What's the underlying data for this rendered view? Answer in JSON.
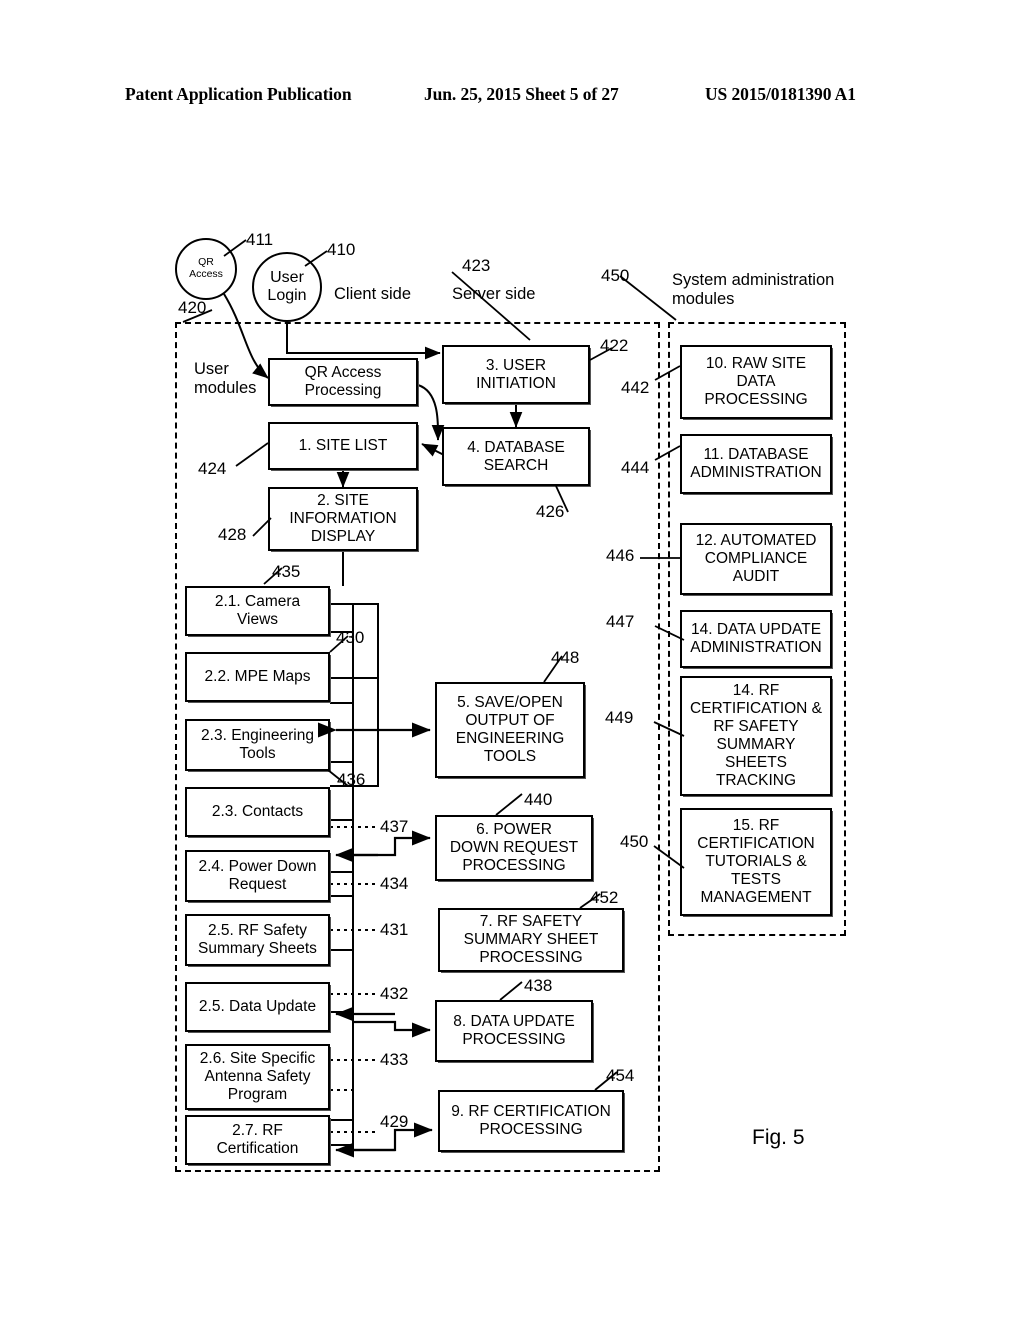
{
  "header": {
    "publication": "Patent Application Publication",
    "date_sheet": "Jun. 25, 2015  Sheet 5 of 27",
    "patent_number": "US 2015/0181390 A1"
  },
  "figure": {
    "label": "Fig. 5"
  },
  "entry_points": {
    "qr_access": "QR\nAccess",
    "user_login": "User\nLogin"
  },
  "side_labels": {
    "client_side": "Client side",
    "server_side": "Server side"
  },
  "group_labels": {
    "user_modules": "User\nmodules",
    "system_administration_modules": "System administration\nmodules"
  },
  "client_boxes": {
    "qr_access_processing": "QR Access\nProcessing",
    "site_list": "1. SITE LIST",
    "site_information_display": "2. SITE\nINFORMATION\nDISPLAY"
  },
  "sub_modules": [
    {
      "id": "camera-views",
      "label": "2.1. Camera\nViews"
    },
    {
      "id": "mpe-maps",
      "label": "2.2. MPE Maps"
    },
    {
      "id": "engineering-tools",
      "label": "2.3. Engineering\nTools"
    },
    {
      "id": "contacts",
      "label": "2.3. Contacts"
    },
    {
      "id": "power-down-request",
      "label": "2.4. Power Down\nRequest"
    },
    {
      "id": "rf-safety-summary",
      "label": "2.5. RF Safety\nSummary Sheets"
    },
    {
      "id": "data-update",
      "label": "2.5. Data Update"
    },
    {
      "id": "site-specific-antenna",
      "label": "2.6. Site Specific\nAntenna Safety\nProgram"
    },
    {
      "id": "rf-certification",
      "label": "2.7.  RF\nCertification"
    }
  ],
  "server_boxes": [
    {
      "id": "user-initiation",
      "label": "3. USER\nINITIATION"
    },
    {
      "id": "database-search",
      "label": "4. DATABASE\nSEARCH"
    },
    {
      "id": "save-open-output",
      "label": "5. SAVE/OPEN\nOUTPUT OF\nENGINEERING\nTOOLS"
    },
    {
      "id": "power-down-processing",
      "label": "6. POWER\nDOWN REQUEST\nPROCESSING"
    },
    {
      "id": "rf-safety-sheet-proc",
      "label": "7. RF SAFETY\nSUMMARY SHEET\nPROCESSING"
    },
    {
      "id": "data-update-processing",
      "label": "8. DATA UPDATE\nPROCESSING"
    },
    {
      "id": "rf-cert-processing",
      "label": "9. RF CERTIFICATION\nPROCESSING"
    }
  ],
  "admin_boxes": [
    {
      "id": "raw-site-data",
      "label": "10. RAW SITE\nDATA\nPROCESSING"
    },
    {
      "id": "database-admin",
      "label": "11. DATABASE\nADMINISTRATION"
    },
    {
      "id": "compliance-audit",
      "label": "12. AUTOMATED\nCOMPLIANCE\nAUDIT"
    },
    {
      "id": "data-update-admin",
      "label": "14. DATA UPDATE\nADMINISTRATION"
    },
    {
      "id": "rf-cert-tracking",
      "label": "14. RF\nCERTIFICATION &\nRF SAFETY\nSUMMARY\nSHEETS\nTRACKING"
    },
    {
      "id": "rf-cert-tutorials",
      "label": "15. RF\nCERTIFICATION\nTUTORIALS &\nTESTS\nMANAGEMENT"
    }
  ],
  "reference_numerals": {
    "n410": "410",
    "n411": "411",
    "n420": "420",
    "n422": "422",
    "n423": "423",
    "n424": "424",
    "n426": "426",
    "n428": "428",
    "n429": "429",
    "n430": "430",
    "n431": "431",
    "n432": "432",
    "n433": "433",
    "n434": "434",
    "n435": "435",
    "n436": "436",
    "n437": "437",
    "n438": "438",
    "n440": "440",
    "n442": "442",
    "n444": "444",
    "n446": "446",
    "n447": "447",
    "n448": "448",
    "n449": "449",
    "n450_admin": "450",
    "n450_tutorials": "450",
    "n452": "452",
    "n454": "454"
  },
  "colors": {
    "line": "#000000",
    "background": "#ffffff",
    "box_shadow": "#555555"
  }
}
